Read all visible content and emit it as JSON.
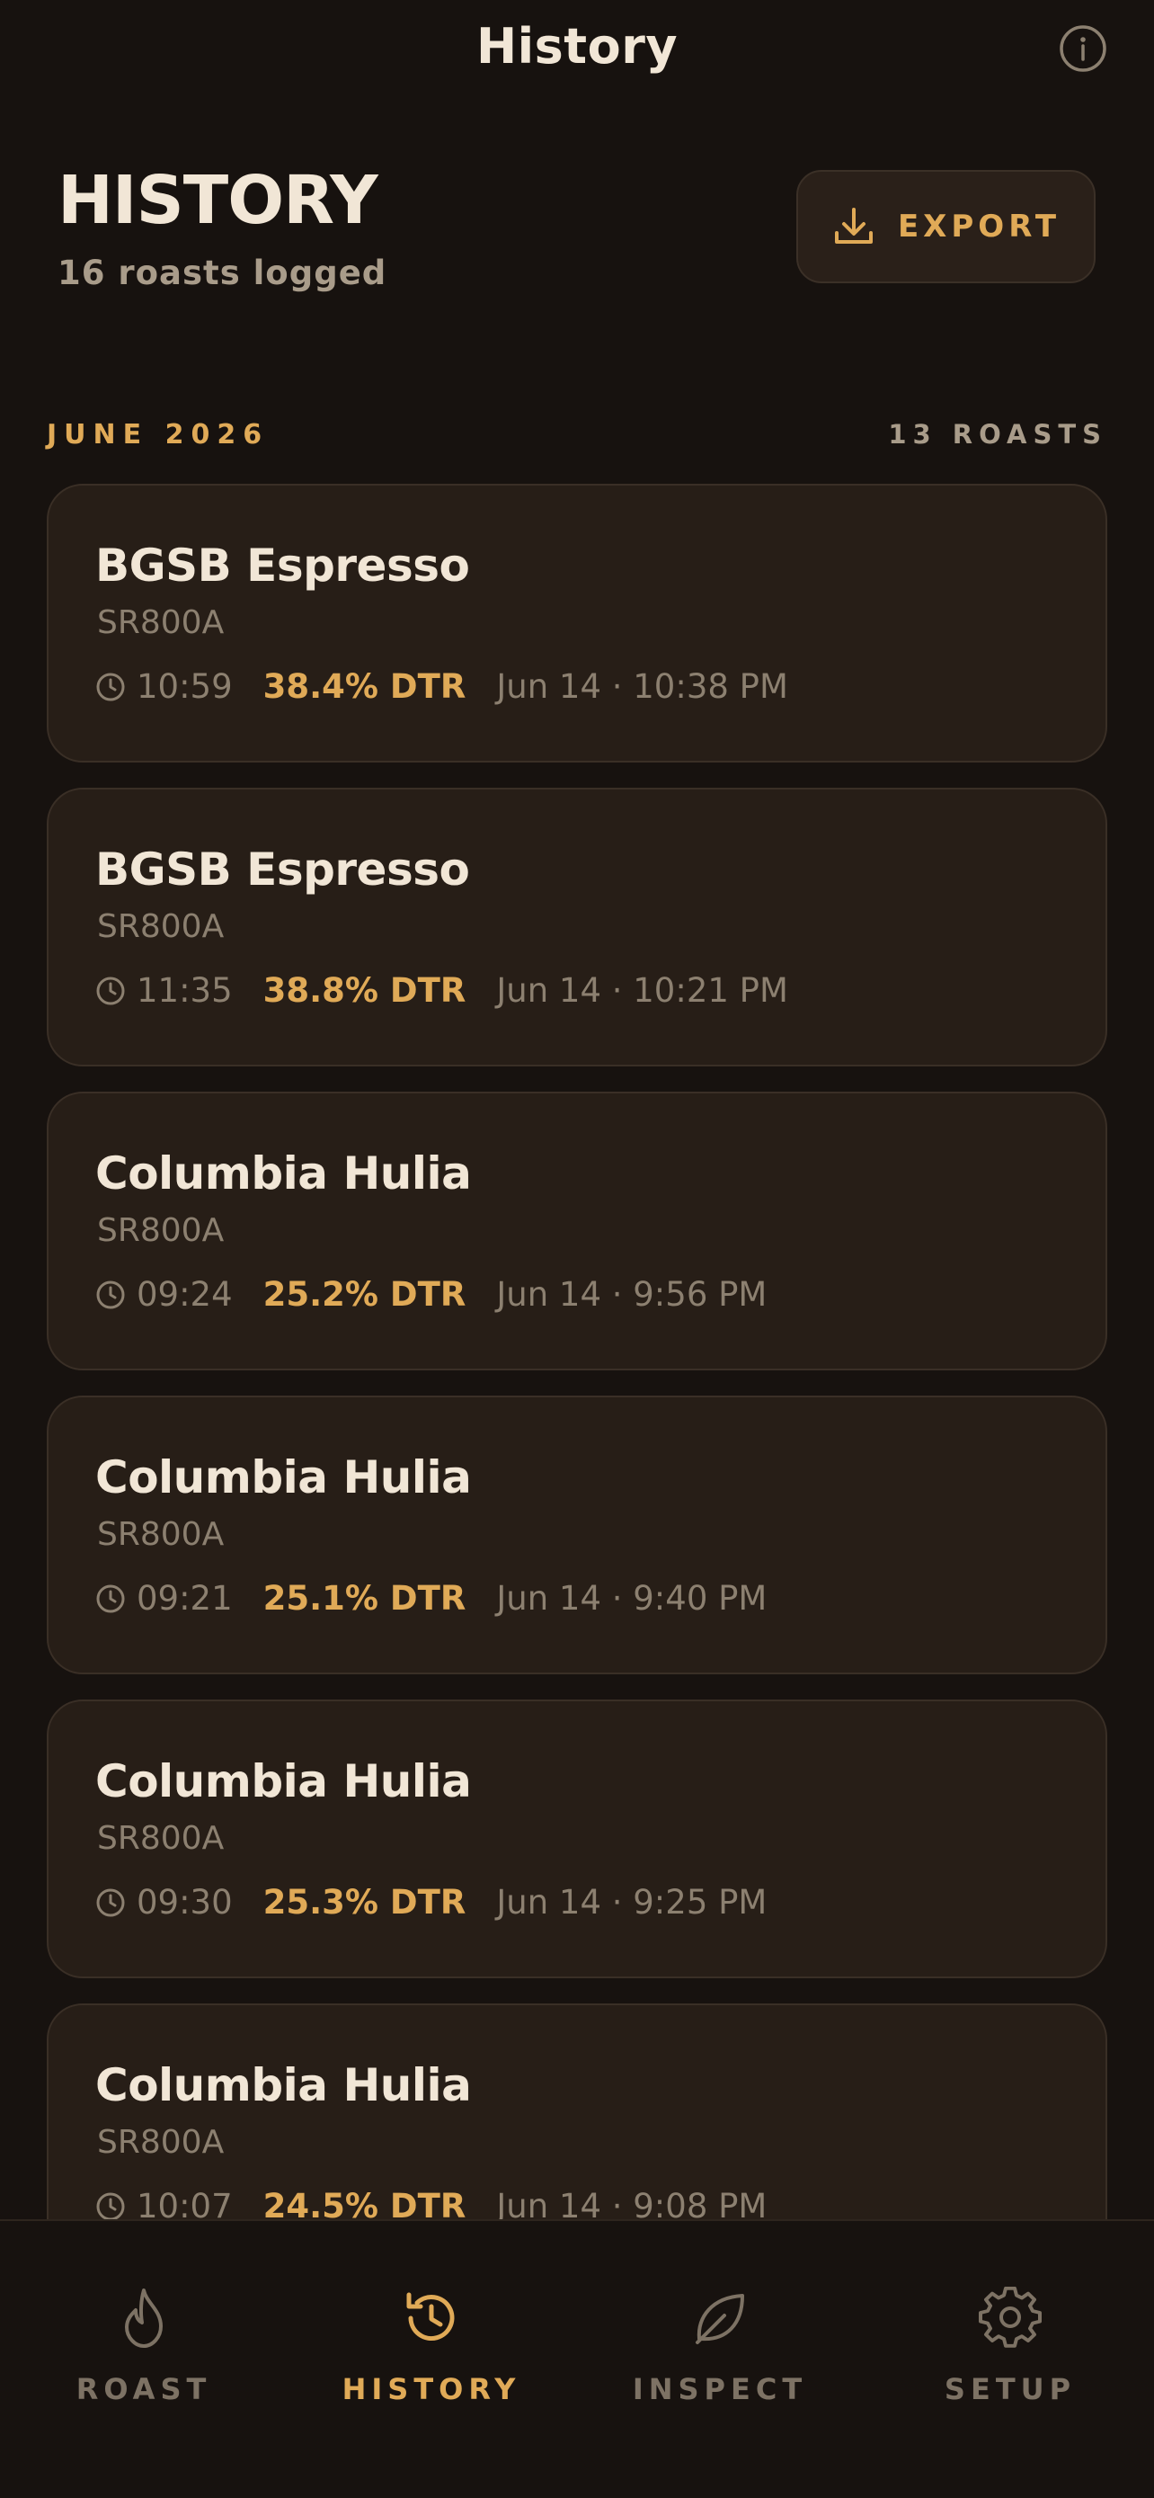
{
  "nav": {
    "title": "History"
  },
  "header": {
    "title": "HISTORY",
    "subtitle": "16 roasts logged",
    "export_label": "EXPORT"
  },
  "section": {
    "month": "JUNE 2026",
    "count": "13 ROASTS"
  },
  "roasts": [
    {
      "name": "BGSB Espresso",
      "machine": "SR800A",
      "duration": "10:59",
      "dtr": "38.4% DTR",
      "when": "Jun 14 · 10:38 PM"
    },
    {
      "name": "BGSB Espresso",
      "machine": "SR800A",
      "duration": "11:35",
      "dtr": "38.8% DTR",
      "when": "Jun 14 · 10:21 PM"
    },
    {
      "name": "Columbia Hulia",
      "machine": "SR800A",
      "duration": "09:24",
      "dtr": "25.2% DTR",
      "when": "Jun 14 · 9:56 PM"
    },
    {
      "name": "Columbia Hulia",
      "machine": "SR800A",
      "duration": "09:21",
      "dtr": "25.1% DTR",
      "when": "Jun 14 · 9:40 PM"
    },
    {
      "name": "Columbia Hulia",
      "machine": "SR800A",
      "duration": "09:30",
      "dtr": "25.3% DTR",
      "when": "Jun 14 · 9:25 PM"
    },
    {
      "name": "Columbia Hulia",
      "machine": "SR800A",
      "duration": "10:07",
      "dtr": "24.5% DTR",
      "when": "Jun 14 · 9:08 PM"
    }
  ],
  "tabs": [
    {
      "label": "ROAST",
      "icon": "flame-icon"
    },
    {
      "label": "HISTORY",
      "icon": "history-icon"
    },
    {
      "label": "INSPECT",
      "icon": "leaf-icon"
    },
    {
      "label": "SETUP",
      "icon": "gear-icon"
    }
  ],
  "colors": {
    "accent": "#e0aa57",
    "background": "#17120f",
    "card": "#271e17"
  }
}
